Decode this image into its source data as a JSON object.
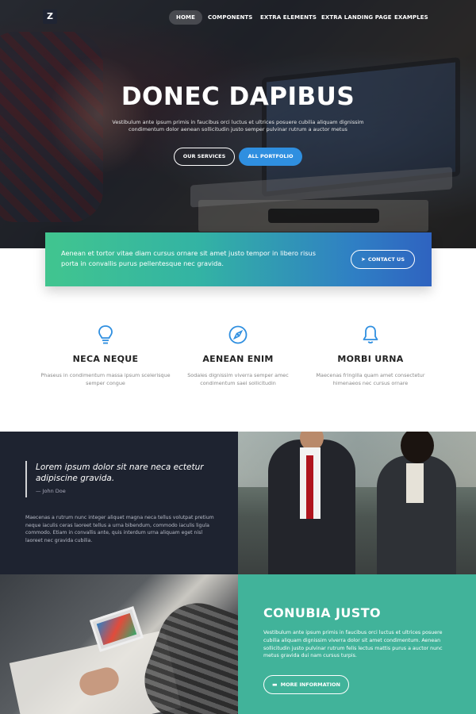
{
  "nav": {
    "logo": "Z",
    "items": [
      {
        "label": "HOME",
        "active": true
      },
      {
        "label": "COMPONENTS",
        "active": false
      },
      {
        "label": "EXTRA ELEMENTS",
        "active": false
      },
      {
        "label": "EXTRA LANDING PAGE",
        "active": false
      },
      {
        "label": "EXAMPLES",
        "active": false
      }
    ]
  },
  "hero": {
    "title": "DONEC DAPIBUS",
    "subtitle": "Vestibulum ante ipsum primis in faucibus orci luctus et ultrices posuere cubilia aliquam dignissim condimentum dolor aenean sollicitudin justo semper pulvinar rutrum a auctor metus",
    "btn_services": "OUR SERVICES",
    "btn_portfolio": "ALL PORTFOLIO"
  },
  "cta": {
    "text": "Aenean et tortor vitae diam cursus ornare sit amet justo tempor in libero risus porta in convallis purus pellentesque nec gravida.",
    "button": "CONTACT US",
    "button_icon": "paper-plane-icon"
  },
  "features": [
    {
      "icon": "lightbulb-icon",
      "title": "NECA NEQUE",
      "desc": "Phaseus in condimentum massa ipsum scelerisque semper congue"
    },
    {
      "icon": "compass-icon",
      "title": "AENEAN ENIM",
      "desc": "Sodales dignissim viverra semper amec condimentum saei sollicitudin"
    },
    {
      "icon": "bell-icon",
      "title": "MORBI URNA",
      "desc": "Maecenas fringilla quam amet consectetur himenaeos nec cursus ornare"
    }
  ],
  "quote": {
    "text": "Lorem ipsum dolor sit nare neca ectetur adipiscine gravida.",
    "author": "— John Doe",
    "body": "Maecenas a rutrum nunc integer aliquet magna neca tellus volutpat pretium neque iaculis ceras laoreet tellus a urna bibendum, commodo iaculis ligula commodo. Etiam in convallis ante, quis interdum urna aliquam eget nisl laoreet nec gravida cubilia."
  },
  "conubia": {
    "title": "CONUBIA JUSTO",
    "body": "Vestibulum ante ipsum primis in faucibus orci luctus et ultrices posuere cubilia aliquam dignissim viverra dolor sit amet condimentum. Aenean sollicitudin justo pulvinar rutrum felis lectus mattis purus a auctor nunc metus gravida dui nam cursus turpis.",
    "button": "MORE INFORMATION",
    "button_icon": "folder-icon"
  },
  "colors": {
    "accent_blue": "#2f8fe0",
    "teal": "#41b39a",
    "dark_navy": "#1e2330",
    "icon_blue": "#2f8fe0"
  }
}
